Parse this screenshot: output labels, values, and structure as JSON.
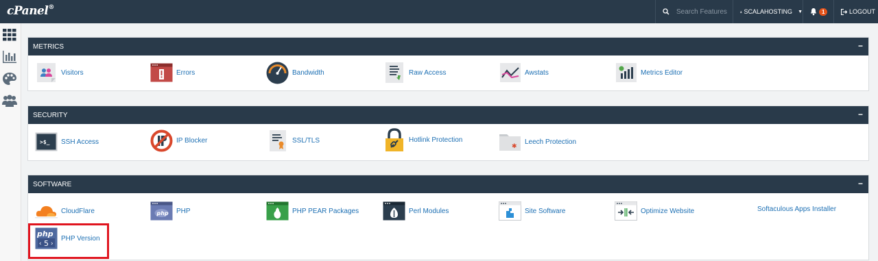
{
  "topbar": {
    "logo": "cPanel",
    "search_placeholder": "Search Features",
    "user": "SCALAHOSTING",
    "notifications": "1",
    "logout": "LOGOUT"
  },
  "sidebar": [
    "grid-icon",
    "stats-icon",
    "palette-icon",
    "users-icon"
  ],
  "panels": {
    "metrics": {
      "title": "METRICS",
      "items": [
        "Visitors",
        "Errors",
        "Bandwidth",
        "Raw Access",
        "Awstats",
        "Metrics Editor"
      ]
    },
    "security": {
      "title": "SECURITY",
      "items": [
        "SSH Access",
        "IP Blocker",
        "SSL/TLS",
        "Hotlink Protection",
        "Leech Protection"
      ]
    },
    "software": {
      "title": "SOFTWARE",
      "items": [
        "CloudFlare",
        "PHP",
        "PHP PEAR Packages",
        "Perl Modules",
        "Site Software",
        "Optimize Website",
        "Softaculous Apps Installer",
        "PHP Version"
      ]
    }
  },
  "colors": {
    "header": "#293a4a",
    "link": "#1c6fb3",
    "highlight": "#e0141e"
  },
  "icon_texts": {
    "ssh": ">$_",
    "php": "php",
    "php_version_num": "5"
  }
}
